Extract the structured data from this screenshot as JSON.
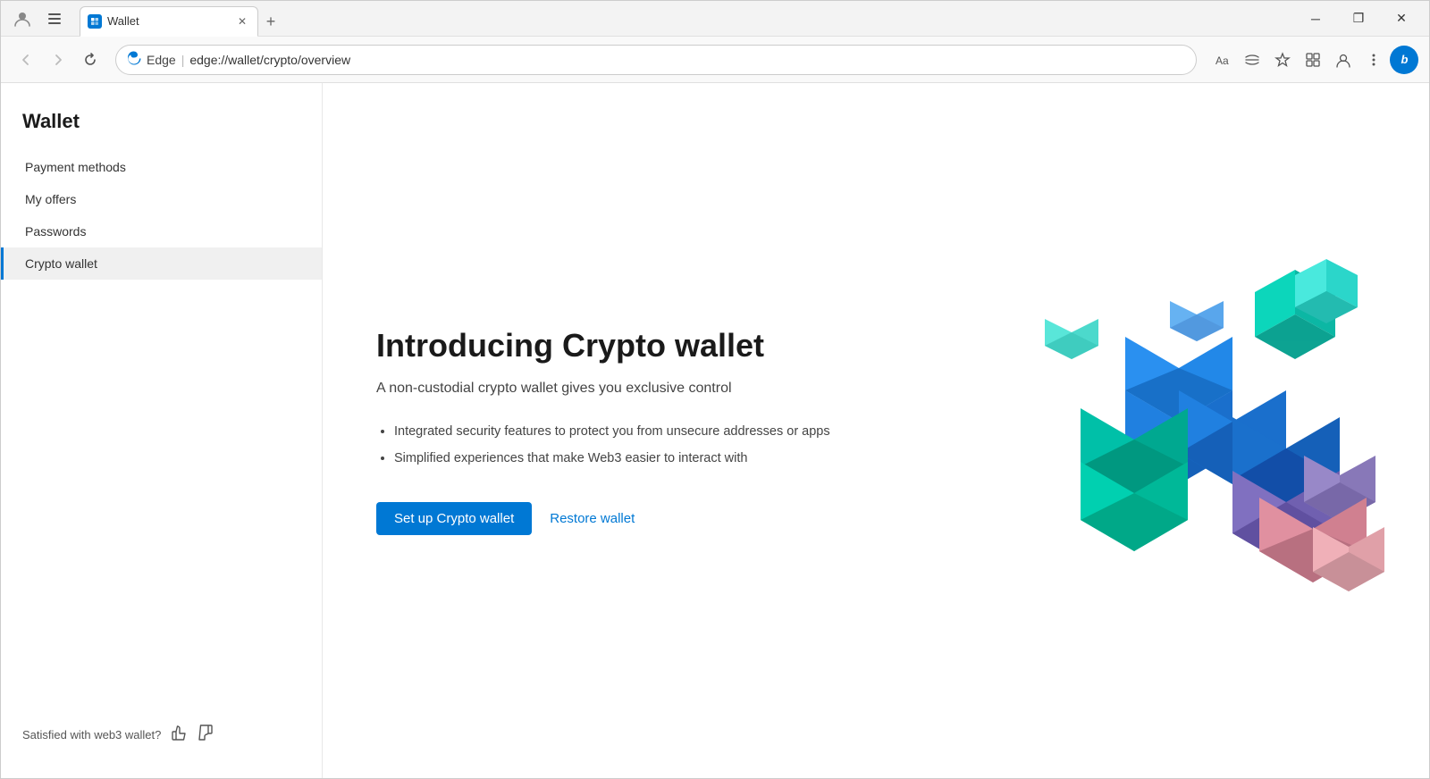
{
  "browser": {
    "tab_title": "Wallet",
    "tab_new_label": "+",
    "win_minimize": "─",
    "win_restore": "❐",
    "win_close": "✕",
    "nav": {
      "back_label": "←",
      "forward_label": "→",
      "refresh_label": "↻",
      "edge_icon_label": "⊕",
      "edge_label": "Edge",
      "separator": "|",
      "url": "edge://wallet/crypto/overview",
      "tools": {
        "read_aloud": "Aa",
        "immersive": "◈",
        "favorites": "☆",
        "collections": "⊞",
        "profile": "👤",
        "more": "…",
        "bing": "b"
      }
    }
  },
  "sidebar": {
    "title": "Wallet",
    "nav_items": [
      {
        "id": "payment-methods",
        "label": "Payment methods",
        "active": false
      },
      {
        "id": "my-offers",
        "label": "My offers",
        "active": false
      },
      {
        "id": "passwords",
        "label": "Passwords",
        "active": false
      },
      {
        "id": "crypto-wallet",
        "label": "Crypto wallet",
        "active": true
      }
    ],
    "footer": {
      "text": "Satisfied with web3 wallet?",
      "thumbup": "👍",
      "thumbdown": "👎"
    }
  },
  "content": {
    "heading": "Introducing Crypto wallet",
    "subheading": "A non-custodial crypto wallet gives you exclusive control",
    "bullets": [
      "Integrated security features to protect you from unsecure addresses or apps",
      "Simplified experiences that make Web3 easier to interact with"
    ],
    "btn_setup": "Set up Crypto wallet",
    "btn_restore": "Restore wallet"
  }
}
